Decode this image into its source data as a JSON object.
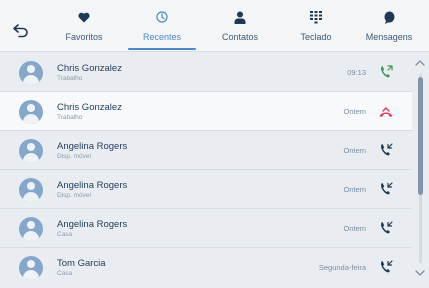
{
  "tabs": [
    {
      "label": "Favoritos",
      "icon": "heart-icon"
    },
    {
      "label": "Recentes",
      "icon": "clock-icon"
    },
    {
      "label": "Contatos",
      "icon": "person-icon"
    },
    {
      "label": "Teclado",
      "icon": "keypad-icon"
    },
    {
      "label": "Mensagens",
      "icon": "message-icon"
    }
  ],
  "active_tab": "Recentes",
  "calls": [
    {
      "name": "Chris Gonzalez",
      "type": "Trabalho",
      "time": "09:13",
      "status": "outgoing"
    },
    {
      "name": "Chris Gonzalez",
      "type": "Trabalho",
      "time": "Ontem",
      "status": "missed"
    },
    {
      "name": "Angelina Rogers",
      "type": "Disp. móvel",
      "time": "Ontem",
      "status": "incoming"
    },
    {
      "name": "Angelina Rogers",
      "type": "Disp. móvel",
      "time": "Ontem",
      "status": "incoming"
    },
    {
      "name": "Angelina Rogers",
      "type": "Casa",
      "time": "Ontem",
      "status": "incoming"
    },
    {
      "name": "Tom Garcia",
      "type": "Casa",
      "time": "Segunda-feira",
      "status": "incoming"
    }
  ],
  "colors": {
    "accent": "#4f88c9",
    "call_green": "#3f9a52",
    "missed_red": "#e2355f",
    "icon_navy": "#1f3954"
  }
}
